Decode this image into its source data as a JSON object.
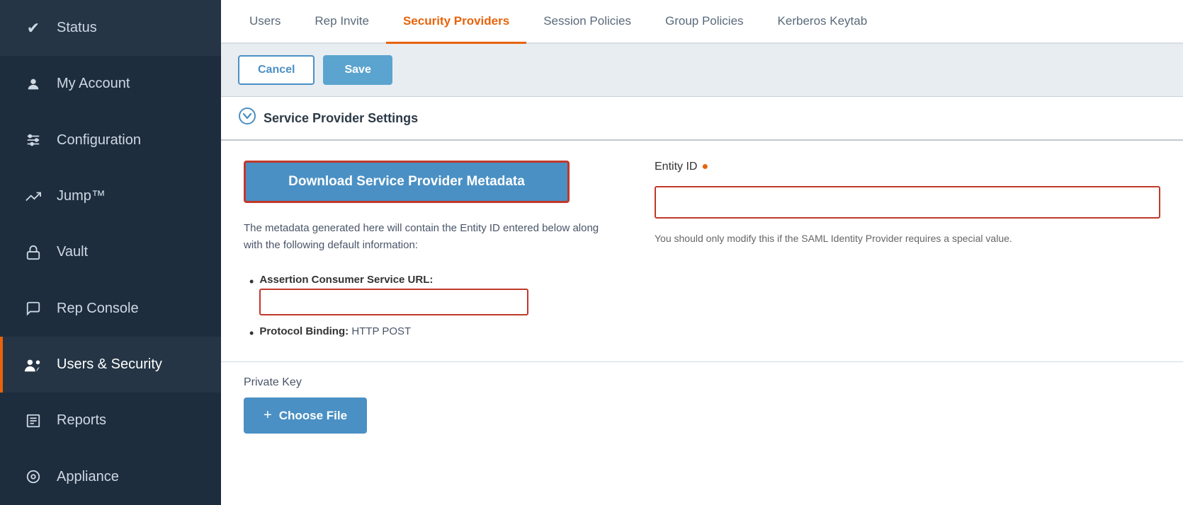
{
  "sidebar": {
    "items": [
      {
        "id": "status",
        "label": "Status",
        "icon": "✓",
        "active": false
      },
      {
        "id": "my-account",
        "label": "My Account",
        "icon": "👤",
        "active": false
      },
      {
        "id": "configuration",
        "label": "Configuration",
        "icon": "≡",
        "active": false
      },
      {
        "id": "jump",
        "label": "Jump™",
        "icon": "↗",
        "active": false
      },
      {
        "id": "vault",
        "label": "Vault",
        "icon": "🔒",
        "active": false
      },
      {
        "id": "rep-console",
        "label": "Rep Console",
        "icon": "💬",
        "active": false
      },
      {
        "id": "users-security",
        "label": "Users & Security",
        "icon": "👥",
        "active": true
      },
      {
        "id": "reports",
        "label": "Reports",
        "icon": "📋",
        "active": false
      },
      {
        "id": "appliance",
        "label": "Appliance",
        "icon": "⊙",
        "active": false
      }
    ]
  },
  "tabs": [
    {
      "id": "users",
      "label": "Users",
      "active": false
    },
    {
      "id": "rep-invite",
      "label": "Rep Invite",
      "active": false
    },
    {
      "id": "security-providers",
      "label": "Security Providers",
      "active": true
    },
    {
      "id": "session-policies",
      "label": "Session Policies",
      "active": false
    },
    {
      "id": "group-policies",
      "label": "Group Policies",
      "active": false
    },
    {
      "id": "kerberos-keytab",
      "label": "Kerberos Keytab",
      "active": false
    }
  ],
  "toolbar": {
    "cancel_label": "Cancel",
    "save_label": "Save"
  },
  "section": {
    "title": "Service Provider Settings",
    "chevron": "▼"
  },
  "download_button": {
    "label": "Download Service Provider Metadata"
  },
  "metadata": {
    "description": "The metadata generated here will contain the Entity ID entered below along with the following default information:",
    "assertion_consumer_url_label": "Assertion Consumer Service URL:",
    "assertion_consumer_url_placeholder": "",
    "protocol_binding_label": "Protocol Binding:",
    "protocol_binding_value": "HTTP POST"
  },
  "entity_id": {
    "label": "Entity ID",
    "placeholder": "",
    "hint": "You should only modify this if the SAML Identity Provider requires a special value."
  },
  "private_key": {
    "label": "Private Key",
    "choose_file_label": "Choose File",
    "plus_icon": "+"
  }
}
